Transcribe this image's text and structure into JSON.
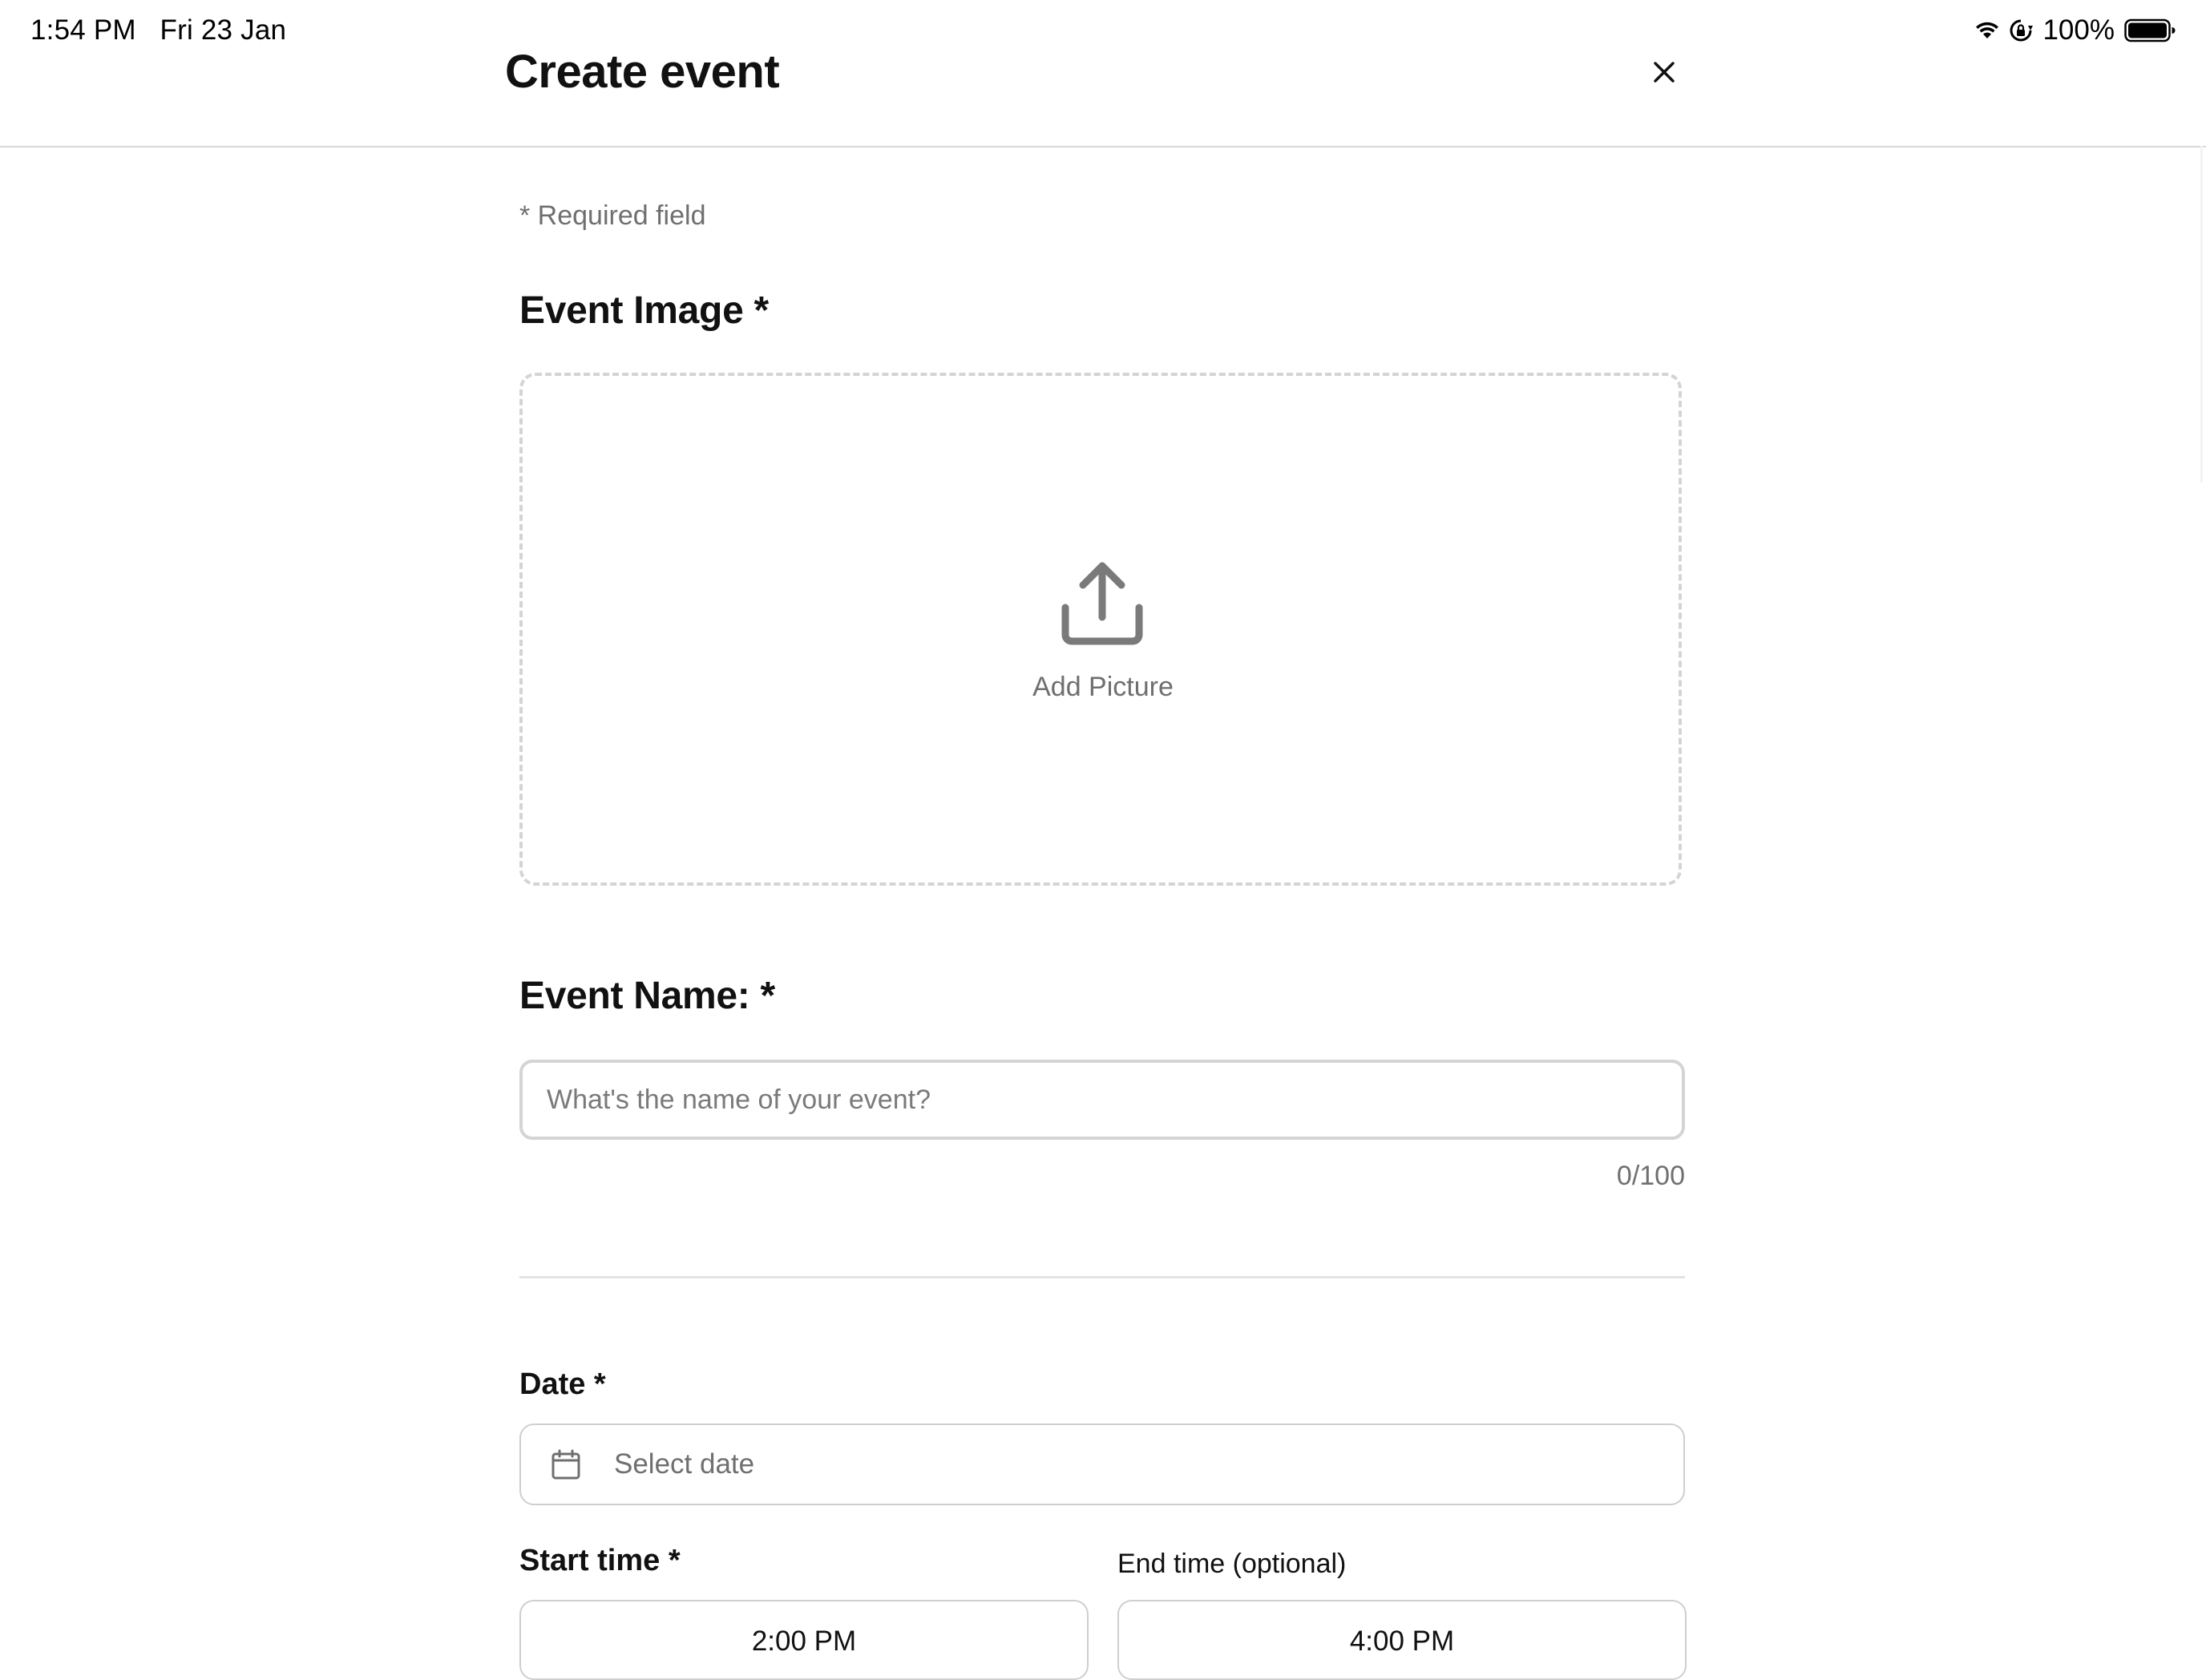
{
  "status_bar": {
    "time": "1:54 PM",
    "date": "Fri 23 Jan",
    "battery": "100%",
    "icons": [
      "wifi-icon",
      "orientation-lock-icon",
      "battery-icon"
    ]
  },
  "header": {
    "title": "Create event",
    "close_icon": "close-icon"
  },
  "form": {
    "required_note": "* Required field",
    "event_image": {
      "label": "Event Image *",
      "upload_icon": "upload-icon",
      "upload_label": "Add Picture"
    },
    "event_name": {
      "label": "Event Name: *",
      "placeholder": "What's the name of your event?",
      "value": "",
      "char_count": "0/100"
    },
    "date": {
      "label": "Date *",
      "icon": "calendar-icon",
      "placeholder": "Select date"
    },
    "start_time": {
      "label": "Start time *",
      "value": "2:00 PM"
    },
    "end_time": {
      "label": "End time (optional)",
      "value": "4:00 PM"
    }
  },
  "colors": {
    "text_primary": "#111111",
    "text_secondary": "#6f6f6f",
    "border": "#d4d4d4",
    "background": "#ffffff"
  }
}
